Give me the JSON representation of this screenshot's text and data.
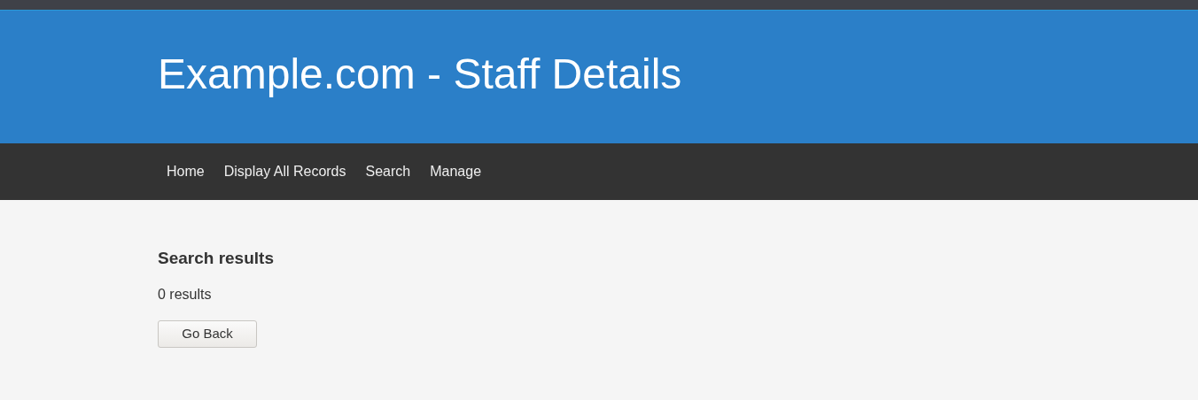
{
  "header": {
    "title": "Example.com - Staff Details"
  },
  "nav": {
    "items": [
      "Home",
      "Display All Records",
      "Search",
      "Manage"
    ]
  },
  "results": {
    "heading": "Search results",
    "count": "0 results",
    "button": "Go Back"
  }
}
